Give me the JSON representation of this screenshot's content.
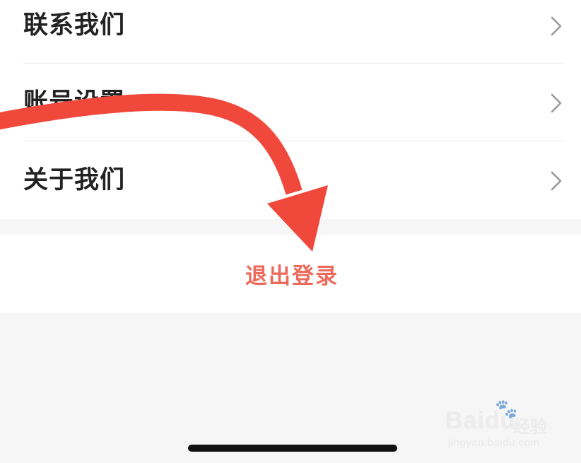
{
  "menu": {
    "items": [
      {
        "label": "联系我们"
      },
      {
        "label": "账号设置"
      },
      {
        "label": "关于我们"
      }
    ]
  },
  "logout": {
    "label": "退出登录",
    "color": "#ec6a5c"
  },
  "annotation": {
    "arrow_color": "#f0493c"
  },
  "watermark": {
    "logo": "Bai",
    "logo_tail": "du",
    "product": "经验",
    "url": "jingyan.baidu.com"
  }
}
